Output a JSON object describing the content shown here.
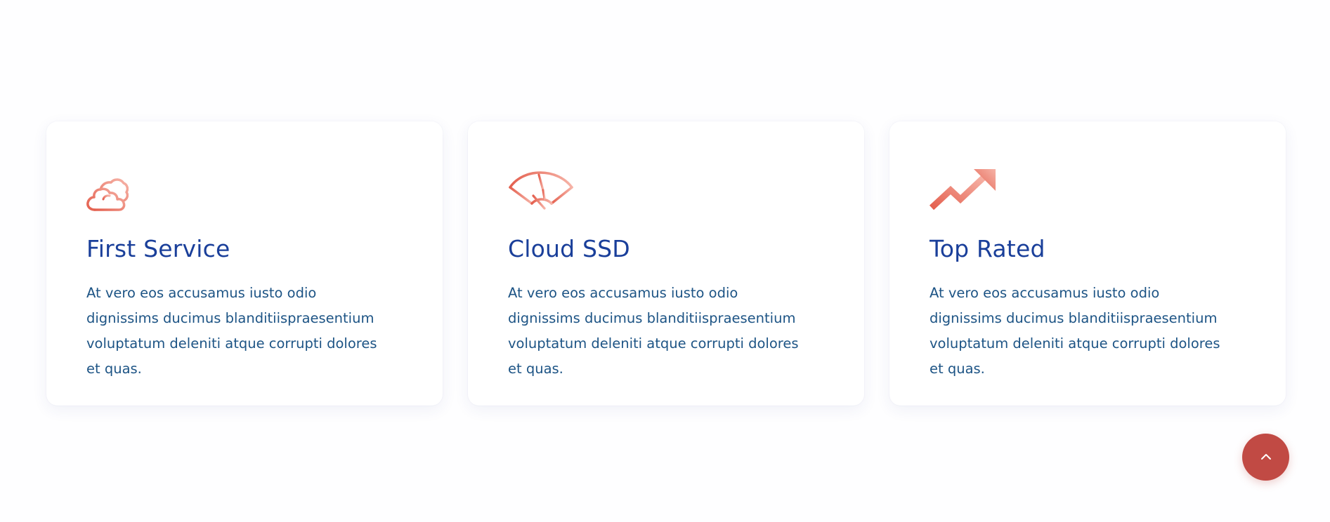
{
  "services": [
    {
      "icon": "cloud-icon",
      "title": "First Service",
      "text": "At vero eos accusamus iusto odio dignissims ducimus blanditiispraesentium voluptatum deleniti atque corrupti dolores et quas."
    },
    {
      "icon": "speedometer-icon",
      "title": "Cloud SSD",
      "text": "At vero eos accusamus iusto odio dignissims ducimus blanditiispraesentium voluptatum deleniti atque corrupti dolores et quas."
    },
    {
      "icon": "trending-up-icon",
      "title": "Top Rated",
      "text": "At vero eos accusamus iusto odio dignissims ducimus blanditiispraesentium voluptatum deleniti atque corrupti dolores et quas."
    }
  ],
  "back_to_top": {
    "icon": "chevron-up-icon"
  },
  "colors": {
    "title": "#1a3f9a",
    "body_text": "#1d5485",
    "icon_gradient_start": "#e4604f",
    "icon_gradient_end": "#f6b3a7",
    "back_to_top_bg": "#c14a44"
  }
}
